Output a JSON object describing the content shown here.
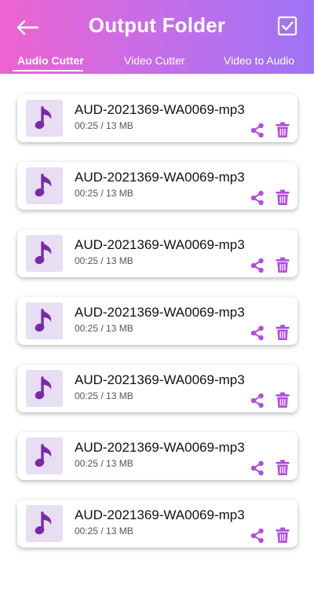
{
  "header": {
    "title": "Output Folder",
    "back_icon": "arrow-left-icon",
    "select_icon": "checkbox-checked-icon",
    "gradient": [
      "#ee63d0",
      "#9c74f6"
    ]
  },
  "tabs": [
    {
      "label": "Audio Cutter",
      "active": true
    },
    {
      "label": "Video Cutter",
      "active": false
    },
    {
      "label": "Video to Audio",
      "active": false
    }
  ],
  "accent_color": "#b24ce0",
  "files": [
    {
      "name": "AUD-2021369-WA0069-mp3",
      "meta": "00:25 / 13 MB"
    },
    {
      "name": "AUD-2021369-WA0069-mp3",
      "meta": "00:25 / 13 MB"
    },
    {
      "name": "AUD-2021369-WA0069-mp3",
      "meta": "00:25 / 13 MB"
    },
    {
      "name": "AUD-2021369-WA0069-mp3",
      "meta": "00:25 / 13 MB"
    },
    {
      "name": "AUD-2021369-WA0069-mp3",
      "meta": "00:25 / 13 MB"
    },
    {
      "name": "AUD-2021369-WA0069-mp3",
      "meta": "00:25 / 13 MB"
    },
    {
      "name": "AUD-2021369-WA0069-mp3",
      "meta": "00:25 / 13 MB"
    }
  ]
}
